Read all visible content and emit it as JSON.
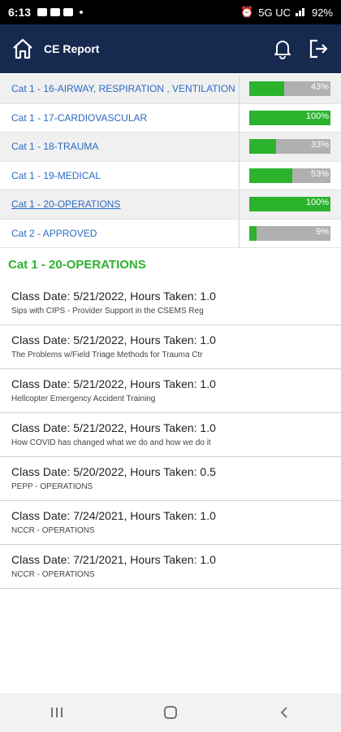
{
  "status_bar": {
    "time": "6:13",
    "network": "5G UC",
    "battery": "92%"
  },
  "header": {
    "title": "CE Report"
  },
  "categories": [
    {
      "label": "Cat 1 - 16-AIRWAY, RESPIRATION , VENTILATION",
      "percent": 43,
      "percent_text": "43%"
    },
    {
      "label": "Cat 1 - 17-CARDIOVASCULAR",
      "percent": 100,
      "percent_text": "100%"
    },
    {
      "label": "Cat 1 - 18-TRAUMA",
      "percent": 33,
      "percent_text": "33%"
    },
    {
      "label": "Cat 1 - 19-MEDICAL",
      "percent": 53,
      "percent_text": "53%"
    },
    {
      "label": "Cat 1 - 20-OPERATIONS",
      "percent": 100,
      "percent_text": "100%"
    },
    {
      "label": "Cat 2 - APPROVED",
      "percent": 9,
      "percent_text": "9%"
    }
  ],
  "selected_category_index": 4,
  "section": {
    "title": "Cat 1 - 20-OPERATIONS"
  },
  "classes": [
    {
      "date": "Class Date: 5/21/2022, Hours Taken: 1.0",
      "name": "Sips with CIPS - Provider Support in the CSEMS Reg"
    },
    {
      "date": "Class Date: 5/21/2022, Hours Taken: 1.0",
      "name": "The Problems w/Field Triage Methods for Trauma Ctr"
    },
    {
      "date": "Class Date: 5/21/2022, Hours Taken: 1.0",
      "name": "Hellcopter Emergency Accident Training"
    },
    {
      "date": "Class Date: 5/21/2022, Hours Taken: 1.0",
      "name": "How COVID has changed what we do and how we do it"
    },
    {
      "date": "Class Date: 5/20/2022, Hours Taken: 0.5",
      "name": "PEPP - OPERATIONS"
    },
    {
      "date": "Class Date: 7/24/2021, Hours Taken: 1.0",
      "name": "NCCR - OPERATIONS"
    },
    {
      "date": "Class Date: 7/21/2021, Hours Taken: 1.0",
      "name": "NCCR - OPERATIONS"
    }
  ],
  "colors": {
    "header_bg": "#16294f",
    "accent_green": "#2bb32e",
    "link_blue": "#2c6ac2",
    "bar_bg": "#b0b0b0"
  },
  "icons": {
    "home": "home-icon",
    "notifications": "bell-icon",
    "logout": "logout-icon"
  }
}
